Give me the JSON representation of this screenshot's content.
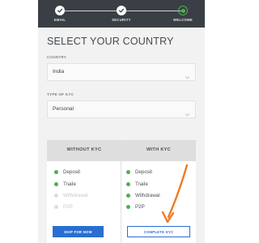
{
  "stepper": {
    "steps": [
      {
        "label": "EMAIL",
        "status": "done"
      },
      {
        "label": "SECURITY",
        "status": "done"
      },
      {
        "label": "WELCOME",
        "status": "current"
      }
    ]
  },
  "page": {
    "title": "SELECT YOUR COUNTRY"
  },
  "form": {
    "country": {
      "label": "COUNTRY",
      "value": "India"
    },
    "kyc_type": {
      "label": "TYPE OF KYC",
      "value": "Personal"
    }
  },
  "comparison": {
    "without": {
      "title": "WITHOUT KYC",
      "features": [
        {
          "label": "Deposit",
          "enabled": true
        },
        {
          "label": "Trade",
          "enabled": true
        },
        {
          "label": "Withdrawal",
          "enabled": false
        },
        {
          "label": "P2P",
          "enabled": false
        }
      ]
    },
    "with": {
      "title": "WITH KYC",
      "features": [
        {
          "label": "Deposit",
          "enabled": true
        },
        {
          "label": "Trade",
          "enabled": true
        },
        {
          "label": "Withdrawal",
          "enabled": true
        },
        {
          "label": "P2P",
          "enabled": true
        }
      ]
    }
  },
  "actions": {
    "skip_label": "SKIP FOR NOW",
    "complete_label": "COMPLETE KYC"
  },
  "colors": {
    "accent": "#2a6ed1",
    "success": "#4cb050",
    "header_bg": "#3a3f45",
    "annotation_arrow": "#f07b22"
  }
}
